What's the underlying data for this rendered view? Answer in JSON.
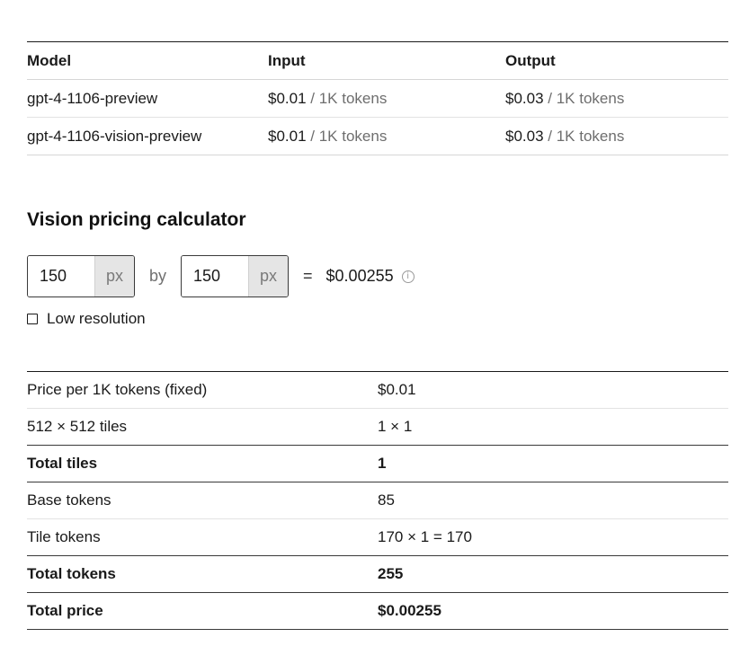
{
  "pricing": {
    "headers": [
      "Model",
      "Input",
      "Output"
    ],
    "rows": [
      {
        "model": "gpt-4-1106-preview",
        "input_price": "$0.01",
        "input_unit": "/ 1K tokens",
        "output_price": "$0.03",
        "output_unit": "/ 1K tokens"
      },
      {
        "model": "gpt-4-1106-vision-preview",
        "input_price": "$0.01",
        "input_unit": "/ 1K tokens",
        "output_price": "$0.03",
        "output_unit": "/ 1K tokens"
      }
    ]
  },
  "calculator": {
    "title": "Vision pricing calculator",
    "width_value": "150",
    "height_value": "150",
    "unit": "px",
    "by_label": "by",
    "equals": "=",
    "result": "$0.00255",
    "info_icon": "info-circle-icon",
    "low_resolution_label": "Low resolution",
    "low_resolution_checked": false
  },
  "breakdown": {
    "rows": [
      {
        "key": "Price per 1K tokens (fixed)",
        "value": "$0.01"
      },
      {
        "key": "512 × 512 tiles",
        "value": "1 × 1"
      },
      {
        "key": "Total tiles",
        "value": "1"
      },
      {
        "key": "Base tokens",
        "value": "85"
      },
      {
        "key": "Tile tokens",
        "value": "170 × 1 = 170"
      },
      {
        "key": "Total tokens",
        "value": "255"
      },
      {
        "key": "Total price",
        "value": "$0.00255"
      }
    ]
  }
}
